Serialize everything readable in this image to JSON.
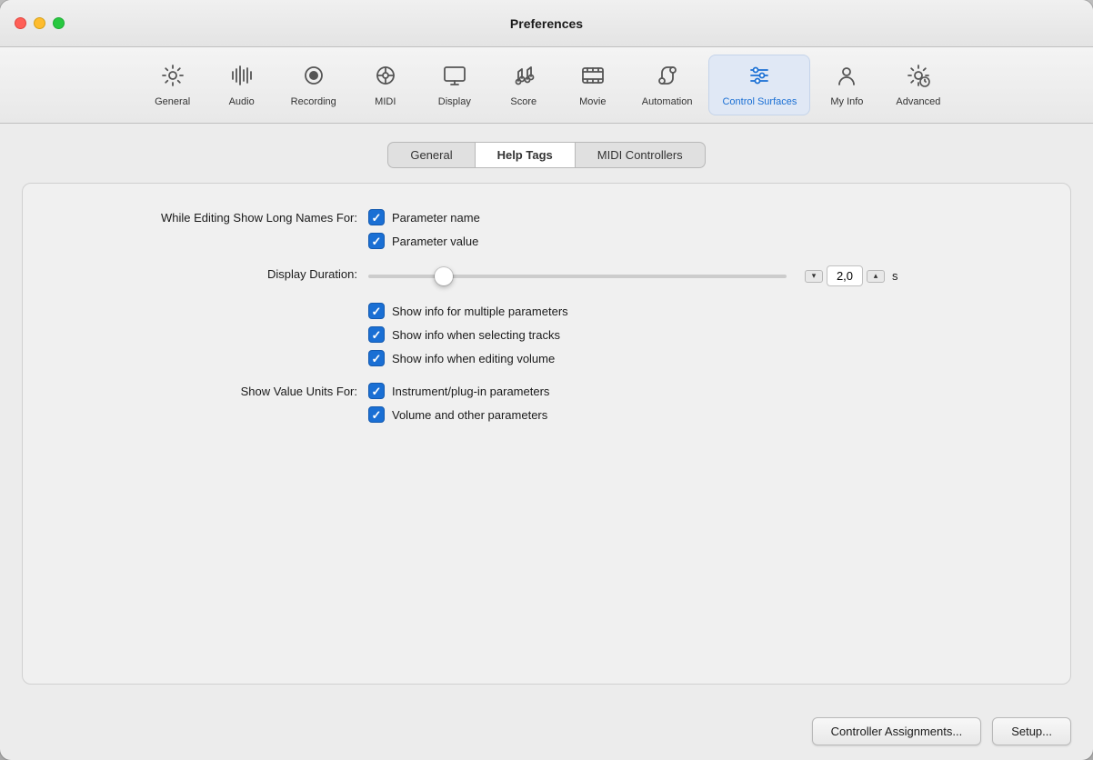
{
  "window": {
    "title": "Preferences"
  },
  "toolbar": {
    "items": [
      {
        "id": "general",
        "label": "General",
        "active": false
      },
      {
        "id": "audio",
        "label": "Audio",
        "active": false
      },
      {
        "id": "recording",
        "label": "Recording",
        "active": false
      },
      {
        "id": "midi",
        "label": "MIDI",
        "active": false
      },
      {
        "id": "display",
        "label": "Display",
        "active": false
      },
      {
        "id": "score",
        "label": "Score",
        "active": false
      },
      {
        "id": "movie",
        "label": "Movie",
        "active": false
      },
      {
        "id": "automation",
        "label": "Automation",
        "active": false
      },
      {
        "id": "control-surfaces",
        "label": "Control Surfaces",
        "active": true
      },
      {
        "id": "my-info",
        "label": "My Info",
        "active": false
      },
      {
        "id": "advanced",
        "label": "Advanced",
        "active": false
      }
    ]
  },
  "subtabs": [
    {
      "id": "general",
      "label": "General",
      "active": false
    },
    {
      "id": "help-tags",
      "label": "Help Tags",
      "active": true
    },
    {
      "id": "midi-controllers",
      "label": "MIDI Controllers",
      "active": false
    }
  ],
  "panel": {
    "while_editing_label": "While Editing Show Long Names For:",
    "checkboxes_editing": [
      {
        "id": "parameter-name",
        "label": "Parameter name",
        "checked": true
      },
      {
        "id": "parameter-value",
        "label": "Parameter value",
        "checked": true
      }
    ],
    "display_duration_label": "Display Duration:",
    "slider_value": "2,0",
    "slider_unit": "s",
    "checkboxes_middle": [
      {
        "id": "show-info-multiple",
        "label": "Show info for multiple parameters",
        "checked": true
      },
      {
        "id": "show-info-selecting",
        "label": "Show info when selecting tracks",
        "checked": true
      },
      {
        "id": "show-info-editing",
        "label": "Show info when editing volume",
        "checked": true
      }
    ],
    "show_value_units_label": "Show Value Units For:",
    "checkboxes_units": [
      {
        "id": "instrument-plugin",
        "label": "Instrument/plug-in parameters",
        "checked": true
      },
      {
        "id": "volume-other",
        "label": "Volume and other parameters",
        "checked": true
      }
    ]
  },
  "bottom_buttons": [
    {
      "id": "controller-assignments",
      "label": "Controller Assignments..."
    },
    {
      "id": "setup",
      "label": "Setup..."
    }
  ],
  "stepper": {
    "down_label": "▾",
    "up_label": "▴"
  }
}
